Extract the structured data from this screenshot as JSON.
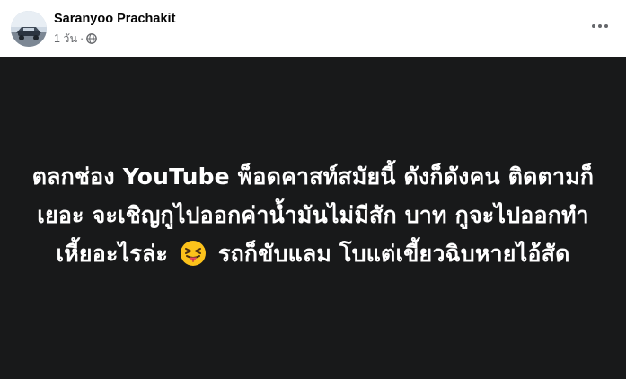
{
  "post": {
    "author": "Saranyoo Prachakit",
    "time": "1 วัน",
    "separator": "·",
    "privacy_icon": "globe-icon",
    "more_icon": "more-horizontal-icon",
    "text_before_emoji": "ตลกช่อง YouTube พ็อดคาสท์สมัยนี้ ดังก็ดังคน ติดตามก็เยอะ จะเชิญกูไปออกค่าน้ำมันไม่มีสัก บาท กูจะไปออกทำเหี้ยอะไรล่ะ",
    "emoji_icon": "squinting-face-with-tongue-emoji",
    "text_after_emoji": "รถก็ขับแลม โบแต่เขี้ยวฉิบหายไอ้สัด",
    "background_color": "#18191a",
    "text_color": "#ffffff"
  }
}
